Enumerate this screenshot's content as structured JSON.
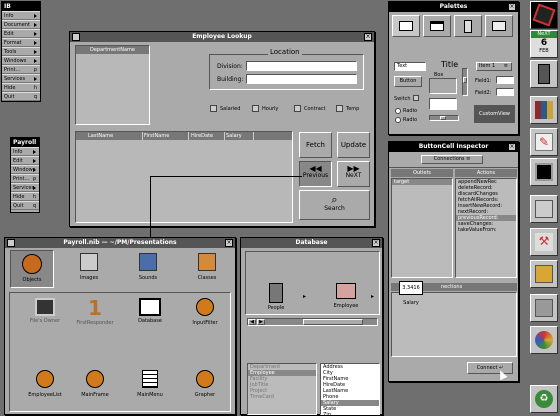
{
  "main_menu": {
    "title": "IB",
    "items": [
      {
        "label": "Info",
        "key": ""
      },
      {
        "label": "Document",
        "key": ""
      },
      {
        "label": "Edit",
        "key": ""
      },
      {
        "label": "Format",
        "key": ""
      },
      {
        "label": "Tools",
        "key": ""
      },
      {
        "label": "Windows",
        "key": ""
      },
      {
        "label": "Print...",
        "key": "p"
      },
      {
        "label": "Services",
        "key": ""
      },
      {
        "label": "Hide",
        "key": "h"
      },
      {
        "label": "Quit",
        "key": "q"
      }
    ]
  },
  "payroll_menu": {
    "title": "Payroll",
    "items": [
      {
        "label": "Info",
        "key": ""
      },
      {
        "label": "Edit",
        "key": ""
      },
      {
        "label": "Windows",
        "key": ""
      },
      {
        "label": "Print...",
        "key": "p"
      },
      {
        "label": "Services",
        "key": ""
      },
      {
        "label": "Hide",
        "key": "h"
      },
      {
        "label": "Quit",
        "key": "q"
      }
    ]
  },
  "employee_lookup": {
    "title": "Employee Lookup",
    "department_header": "DepartmentName",
    "location_title": "Location",
    "division_label": "Division:",
    "building_label": "Building:",
    "checkboxes": [
      "Salaried",
      "Hourly",
      "Contract",
      "Temp"
    ],
    "columns": [
      "LastName",
      "FirstName",
      "HireDate",
      "Salary"
    ],
    "buttons": {
      "fetch": "Fetch",
      "update": "Update",
      "previous": "Previous",
      "next": "NeXT",
      "search": "Search"
    }
  },
  "palettes": {
    "title": "Palettes",
    "text_field": "Text",
    "title_label": "Title",
    "item_popup": "Item 1",
    "box_label": "Box",
    "button_label": "Button",
    "field1": "Field1:",
    "field2": "Field2:",
    "switch_label": "Switch",
    "radio1": "Radio",
    "radio2": "Radio",
    "custom_view": "CustomView"
  },
  "inspector": {
    "title": "ButtonCell Inspector",
    "popup": "Connections",
    "outlets_header": "Outlets",
    "actions_header": "Actions",
    "outlets": [
      "target"
    ],
    "actions": [
      "appendNewRec",
      "deleteRecord:",
      "discardChanges",
      "fetchAllRecords:",
      "insertNewRecord:",
      "nextRecord:",
      "previousRecord:",
      "saveChanges:",
      "takeValueFrom:"
    ],
    "connections_label": "nections",
    "connect_button": "Connect"
  },
  "payroll_nib": {
    "title": "Payroll.nib — ~/PM/Presentations",
    "tabs": [
      "Objects",
      "Images",
      "Sounds",
      "Classes"
    ],
    "objects_row1": [
      "File's Owner",
      "FirstResponder",
      "Database",
      "InputFilter"
    ],
    "objects_row2": [
      "EmployeeList",
      "MainFrame",
      "MainMenu",
      "Grapher"
    ]
  },
  "database": {
    "title": "Database",
    "path": [
      "People",
      "Employee",
      "Salary"
    ],
    "salary_value": "3.3416",
    "entities": [
      "Department",
      "Employee",
      "Facility",
      "JobTitle",
      "Project",
      "TimeCard"
    ],
    "attributes": [
      "Address",
      "City",
      "FirstName",
      "HireDate",
      "LastName",
      "Phone",
      "Salary",
      "State",
      "Zip"
    ]
  },
  "dock": {
    "labels": [
      "NeXT",
      "6",
      "FEB"
    ]
  }
}
